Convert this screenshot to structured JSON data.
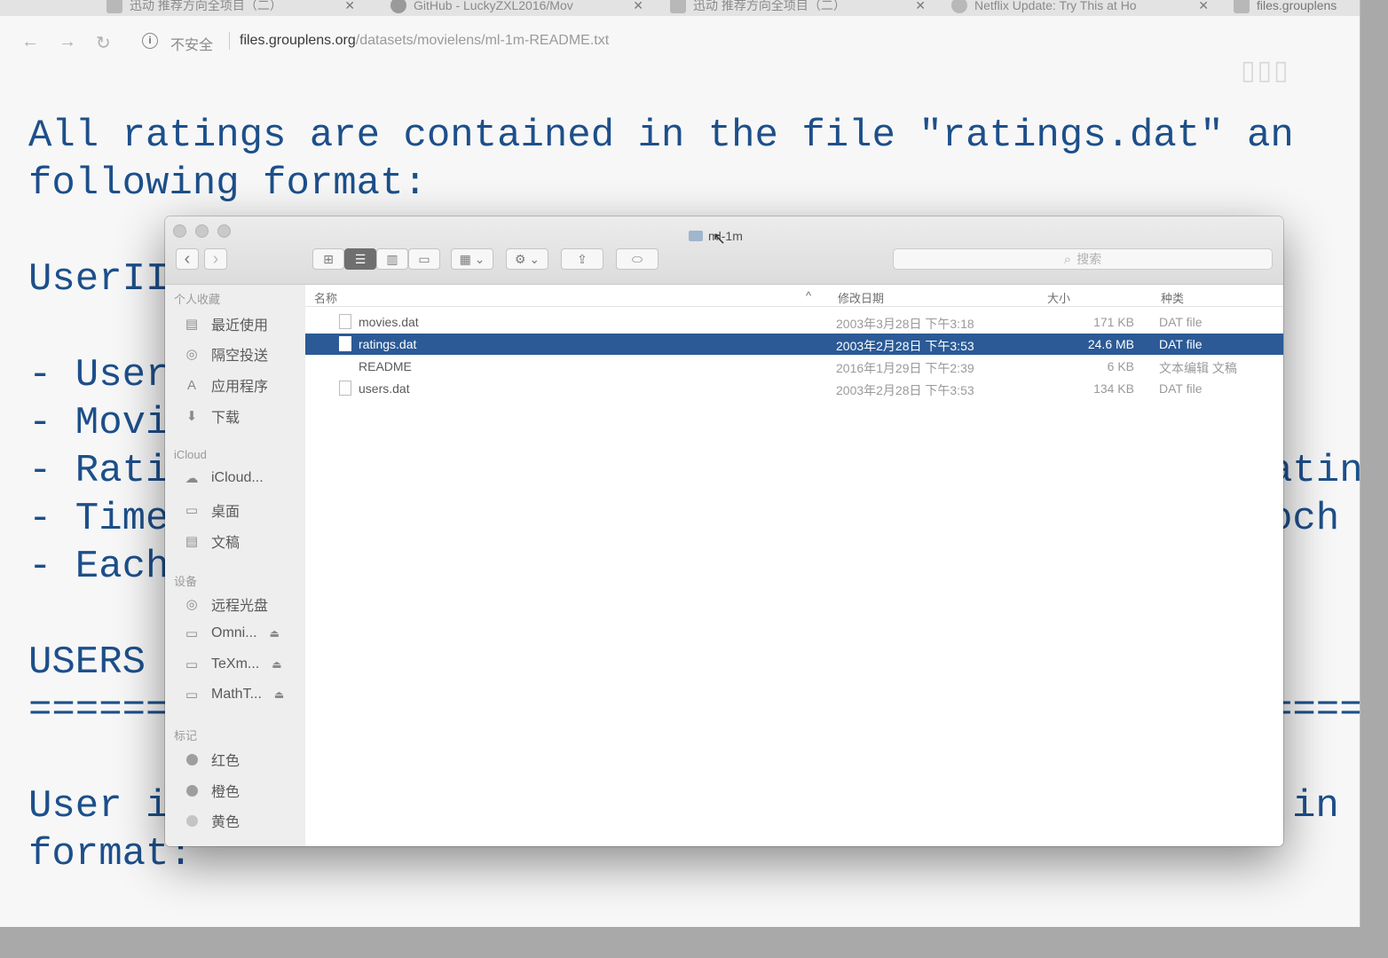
{
  "browser": {
    "tabs": [
      {
        "title": "迅动 推荐方向全项目（二）",
        "close": "✕"
      },
      {
        "title": "GitHub - LuckyZXL2016/Mov",
        "close": "✕"
      },
      {
        "title": "迅动 推荐方向全项目（二）",
        "close": "✕"
      },
      {
        "title": "Netflix Update: Try This at Ho",
        "close": "✕"
      },
      {
        "title": "files.grouplens",
        "close": ""
      }
    ],
    "nav": {
      "back": "←",
      "forward": "→",
      "reload": "↻",
      "info": "i"
    },
    "security_label": "不安全",
    "url_host": "files.grouplens.org",
    "url_path": "/datasets/movielens/ml-1m-README.txt",
    "extension_icon": "▯▯▯"
  },
  "page": {
    "lines": [
      "All ratings are contained in the file \"ratings.dat\" an",
      "following format:",
      "UserII",
      "- User",
      "- Movi",
      "- Rati",
      "- Time",
      "- Each",
      "USERS",
      "======",
      "User i",
      "format:"
    ],
    "right_fragments": [
      "atin",
      "och",
      "=====",
      "in"
    ]
  },
  "finder": {
    "title": "ml-1m",
    "toolbar": {
      "back": "‹",
      "forward": "›",
      "view_icon": "⊞",
      "view_list": "☰",
      "view_columns": "▥",
      "view_coverflow": "▭",
      "arrange": "▦ ⌄",
      "action": "⚙ ⌄",
      "share": "⇪",
      "tags": "⬭",
      "search_placeholder": "搜索"
    },
    "sidebar": {
      "favorites_header": "个人收藏",
      "favorites": [
        {
          "label": "最近使用",
          "icon": "▤"
        },
        {
          "label": "隔空投送",
          "icon": "◎"
        },
        {
          "label": "应用程序",
          "icon": "A"
        },
        {
          "label": "下载",
          "icon": "⬇"
        }
      ],
      "icloud_header": "iCloud",
      "icloud": [
        {
          "label": "iCloud...",
          "icon": "☁"
        },
        {
          "label": "桌面",
          "icon": "▭"
        },
        {
          "label": "文稿",
          "icon": "▤"
        }
      ],
      "devices_header": "设备",
      "devices": [
        {
          "label": "远程光盘",
          "icon": "◎",
          "eject": ""
        },
        {
          "label": "Omni...",
          "icon": "▭",
          "eject": "⏏"
        },
        {
          "label": "TeXm...",
          "icon": "▭",
          "eject": "⏏"
        },
        {
          "label": "MathT...",
          "icon": "▭",
          "eject": "⏏"
        }
      ],
      "tags_header": "标记",
      "tags": [
        {
          "label": "红色"
        },
        {
          "label": "橙色"
        },
        {
          "label": "黄色"
        }
      ]
    },
    "columns": {
      "name": "名称",
      "sort_arrow": "^",
      "date": "修改日期",
      "size": "大小",
      "kind": "种类"
    },
    "files": [
      {
        "name": "movies.dat",
        "date": "2003年3月28日 下午3:18",
        "size": "171 KB",
        "kind": "DAT file"
      },
      {
        "name": "ratings.dat",
        "date": "2003年2月28日 下午3:53",
        "size": "24.6 MB",
        "kind": "DAT file"
      },
      {
        "name": "README",
        "date": "2016年1月29日 下午2:39",
        "size": "6 KB",
        "kind": "文本编辑 文稿"
      },
      {
        "name": "users.dat",
        "date": "2003年2月28日 下午3:53",
        "size": "134 KB",
        "kind": "DAT file"
      }
    ],
    "cursor": "↖"
  }
}
